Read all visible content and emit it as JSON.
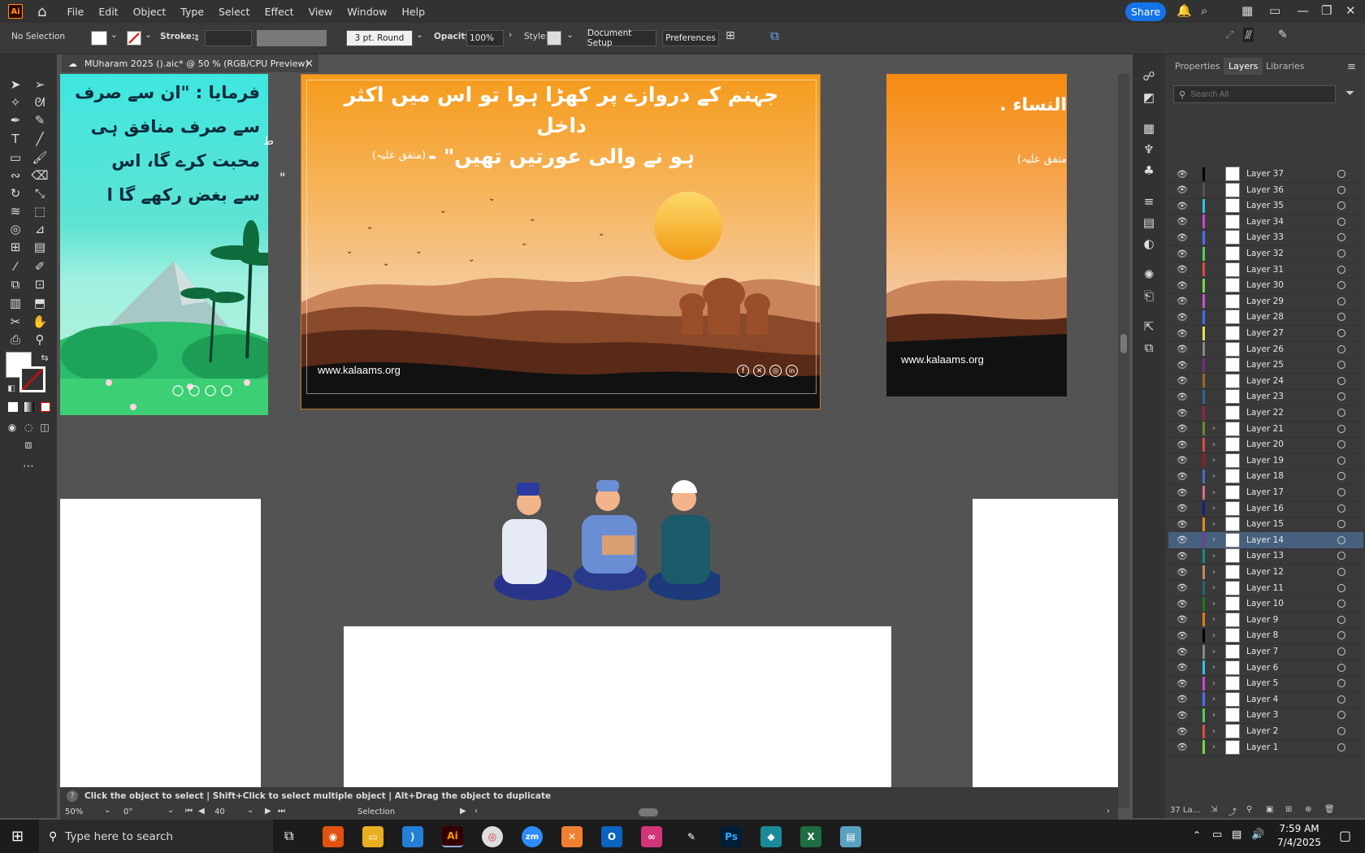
{
  "app": {
    "logo": "Ai",
    "home_icon": "home-icon"
  },
  "menu": [
    "File",
    "Edit",
    "Object",
    "Type",
    "Select",
    "Effect",
    "View",
    "Window",
    "Help"
  ],
  "share_label": "Share",
  "control": {
    "selection": "No Selection",
    "stroke_label": "Stroke:",
    "brush": "3 pt. Round",
    "opacity_label": "Opacity:",
    "opacity_value": "100%",
    "style_label": "Style:",
    "doc_setup": "Document Setup",
    "preferences": "Preferences"
  },
  "doc_tab": {
    "title": "MUharam 2025 ().aic* @ 50 % (RGB/CPU Preview)",
    "close": "×"
  },
  "artboards": {
    "center_text_1": "جہنم کے دروازے پر کھڑا ہوا تو اس میں اکثر داخل",
    "center_text_2": "ہو نے والی عورتیں تھیں\" -",
    "center_ref": "(متفق علیہ)",
    "url": "www.kalaams.org",
    "left_text_1": "فرمایا : \"ان سے صرف",
    "left_text_2": "سے صرف منافق ہی",
    "left_text_3": "محبت کرے گا، اس",
    "left_text_4": "سے بغض رکھے گا ا",
    "right_text_1": "النساء .",
    "right_ref": "متفق علیہ)",
    "quote_mark": "\"",
    "ta_mark": "ط"
  },
  "status": {
    "hint": "Click the object to select  |  Shift+Click to select multiple object  |  Alt+Drag the object to duplicate",
    "zoom": "50%",
    "angle": "0°",
    "artboard": "40",
    "tool": "Selection"
  },
  "panel": {
    "tabs": [
      "Properties",
      "Layers",
      "Libraries"
    ],
    "search_placeholder": "Search All",
    "layer_count": "37 La..."
  },
  "layers": [
    {
      "name": "Layer 37",
      "color": "#000000",
      "expand": false
    },
    {
      "name": "Layer 36",
      "color": "#555555",
      "expand": false
    },
    {
      "name": "Layer 35",
      "color": "#33c3e0",
      "expand": false
    },
    {
      "name": "Layer 34",
      "color": "#d040d0",
      "expand": false
    },
    {
      "name": "Layer 33",
      "color": "#4f6bff",
      "expand": false
    },
    {
      "name": "Layer 32",
      "color": "#55cc55",
      "expand": false
    },
    {
      "name": "Layer 31",
      "color": "#e04848",
      "expand": false
    },
    {
      "name": "Layer 30",
      "color": "#6fda47",
      "expand": false
    },
    {
      "name": "Layer 29",
      "color": "#d050d0",
      "expand": false
    },
    {
      "name": "Layer 28",
      "color": "#3f6fff",
      "expand": false
    },
    {
      "name": "Layer 27",
      "color": "#e3df4d",
      "expand": false
    },
    {
      "name": "Layer 26",
      "color": "#888888",
      "expand": false
    },
    {
      "name": "Layer 25",
      "color": "#7a2a8a",
      "expand": false
    },
    {
      "name": "Layer 24",
      "color": "#9a6a20",
      "expand": false
    },
    {
      "name": "Layer 23",
      "color": "#2a6a9a",
      "expand": false
    },
    {
      "name": "Layer 22",
      "color": "#a02040",
      "expand": false
    },
    {
      "name": "Layer 21",
      "color": "#6a8a2a",
      "expand": true
    },
    {
      "name": "Layer 20",
      "color": "#e04848",
      "expand": true
    },
    {
      "name": "Layer 19",
      "color": "#9a1a1a",
      "expand": true
    },
    {
      "name": "Layer 18",
      "color": "#4a6acc",
      "expand": true
    },
    {
      "name": "Layer 17",
      "color": "#e06a8a",
      "expand": true
    },
    {
      "name": "Layer 16",
      "color": "#1a1a8a",
      "expand": true
    },
    {
      "name": "Layer 15",
      "color": "#e08a20",
      "expand": true
    },
    {
      "name": "Layer 14",
      "color": "#7a3aa0",
      "expand": true
    },
    {
      "name": "Layer 13",
      "color": "#1a8a8a",
      "expand": true
    },
    {
      "name": "Layer 12",
      "color": "#c08a5a",
      "expand": true
    },
    {
      "name": "Layer 11",
      "color": "#1a6a6a",
      "expand": true
    },
    {
      "name": "Layer 10",
      "color": "#1a7a1a",
      "expand": true
    },
    {
      "name": "Layer 9",
      "color": "#e07a1a",
      "expand": true
    },
    {
      "name": "Layer 8",
      "color": "#000000",
      "expand": true
    },
    {
      "name": "Layer 7",
      "color": "#888888",
      "expand": true
    },
    {
      "name": "Layer 6",
      "color": "#33c3e0",
      "expand": true
    },
    {
      "name": "Layer 5",
      "color": "#d040d0",
      "expand": true
    },
    {
      "name": "Layer 4",
      "color": "#4f6bff",
      "expand": true
    },
    {
      "name": "Layer 3",
      "color": "#55cc55",
      "expand": true
    },
    {
      "name": "Layer 2",
      "color": "#e04848",
      "expand": true
    },
    {
      "name": "Layer 1",
      "color": "#6fda47",
      "expand": true
    }
  ],
  "selected_layer": "Layer 14",
  "taskbar": {
    "search_placeholder": "Type here to search",
    "time": "7:59 AM",
    "date": "7/4/2025"
  }
}
